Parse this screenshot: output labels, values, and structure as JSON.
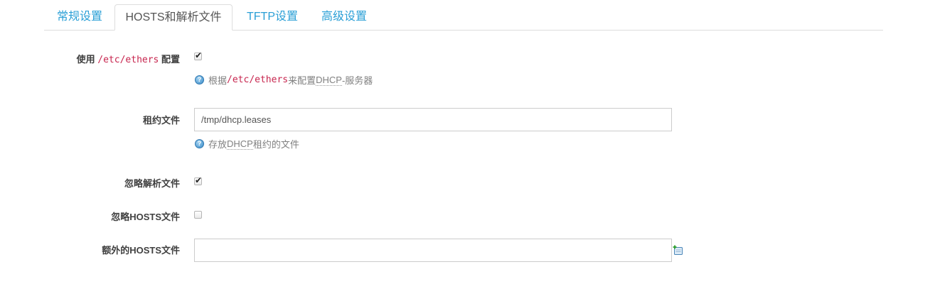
{
  "tabs": [
    {
      "label": "常规设置",
      "active": false
    },
    {
      "label": "HOSTS和解析文件",
      "active": true
    },
    {
      "label": "TFTP设置",
      "active": false
    },
    {
      "label": "高级设置",
      "active": false
    }
  ],
  "fields": {
    "ethers": {
      "label_prefix": "使用 ",
      "label_code": "/etc/ethers",
      "label_suffix": " 配置",
      "checked": true,
      "help_prefix": "根据 ",
      "help_code": "/etc/ethers",
      "help_middle": " 来配置",
      "help_abbr": "DHCP",
      "help_suffix": "-服务器"
    },
    "leasefile": {
      "label": "租约文件",
      "value": "/tmp/dhcp.leases",
      "help_prefix": "存放",
      "help_abbr": "DHCP",
      "help_suffix": "租约的文件"
    },
    "noresolv": {
      "label": "忽略解析文件",
      "checked": true
    },
    "nohosts": {
      "label": "忽略HOSTS文件",
      "checked": false
    },
    "addnhosts": {
      "label": "额外的HOSTS文件",
      "value": ""
    }
  },
  "icons": {
    "help": "help-icon",
    "add": "add-entry-icon",
    "check": "✔"
  },
  "colors": {
    "link": "#2a9fd6",
    "code": "#c7254e",
    "help_text": "#808080"
  }
}
